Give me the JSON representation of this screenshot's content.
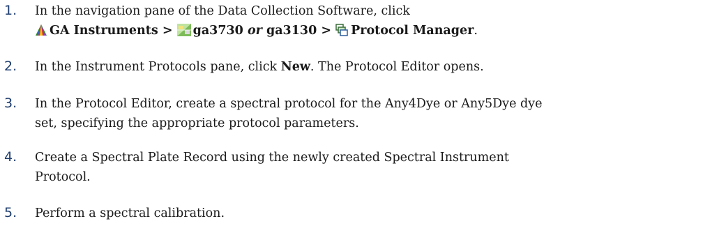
{
  "steps": [
    {
      "number": "1.",
      "text": "In the navigation pane of the Data Collection Software, click",
      "path": {
        "node1": "GA Instruments",
        "sep1": ">",
        "node2a": "ga3730",
        "or": "or",
        "node2b": "ga3130",
        "sep2": ">",
        "node3": "Protocol Manager",
        "end": ".",
        "icons": [
          "ga-instruments-icon",
          "ga3730-instrument-icon",
          "protocol-manager-icon"
        ]
      }
    },
    {
      "number": "2.",
      "before": "In the Instrument Protocols pane, click",
      "bold": "New",
      "after": ". The Protocol Editor opens."
    },
    {
      "number": "3.",
      "line1": "In the Protocol Editor, create a spectral protocol for the Any4Dye or Any5Dye dye",
      "line2": "set, specifying the appropriate protocol parameters."
    },
    {
      "number": "4.",
      "line1": "Create a Spectral Plate Record using the newly created Spectral Instrument",
      "line2": "Protocol."
    },
    {
      "number": "5.",
      "text": "Perform a spectral calibration."
    }
  ],
  "colors": {
    "step_number": "#1e3d6e",
    "body_text": "#1a1a1a"
  }
}
